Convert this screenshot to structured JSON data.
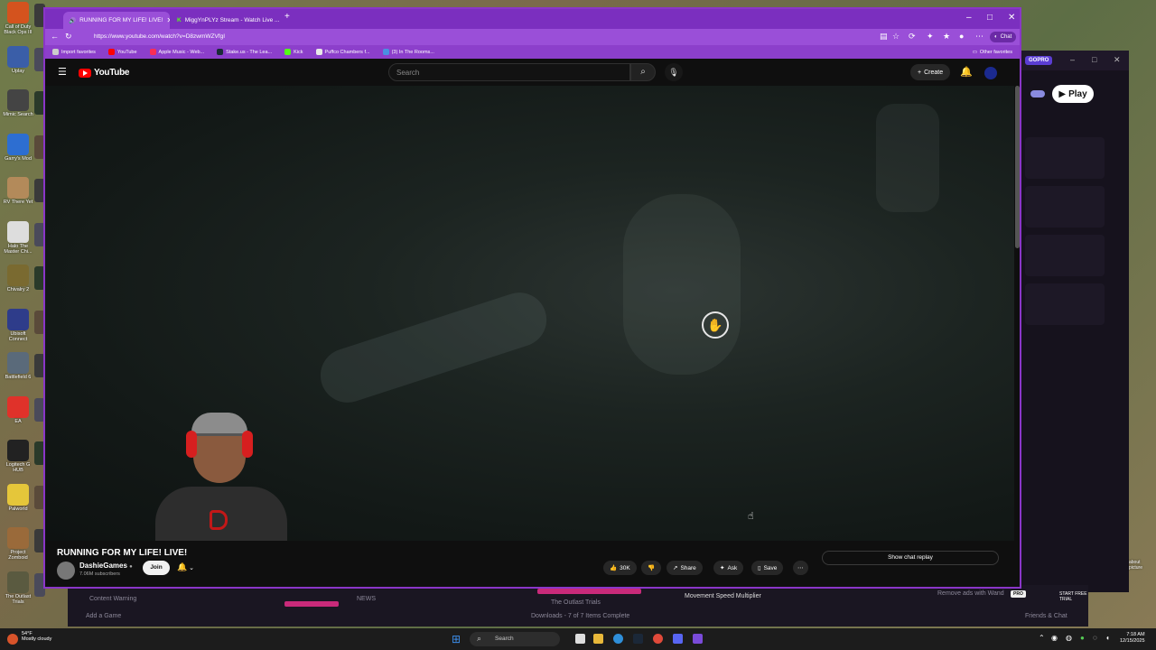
{
  "desktop": {
    "icons": [
      {
        "label": "Call of Duty Black Ops III",
        "color": "#d4531e"
      },
      {
        "label": "Uplay",
        "color": "#3a5ea8"
      },
      {
        "label": "Mimic Search",
        "color": "#444444"
      },
      {
        "label": "Garry's Mod",
        "color": "#2d6ed1"
      },
      {
        "label": "RV There Yet",
        "color": "#b38a5a"
      },
      {
        "label": "Halo The Master Chi...",
        "color": "#dddddd"
      },
      {
        "label": "Chivalry 2",
        "color": "#7a6a30"
      },
      {
        "label": "Ubisoft Connect",
        "color": "#2e3c8a"
      },
      {
        "label": "Battlefield 6",
        "color": "#5a6a7a"
      },
      {
        "label": "EA",
        "color": "#e0322a"
      },
      {
        "label": "Logitech G HUB",
        "color": "#222222"
      },
      {
        "label": "Palworld",
        "color": "#e5c63a"
      },
      {
        "label": "Project Zomboid",
        "color": "#9a6a3a"
      },
      {
        "label": "The Outlast Trials",
        "color": "#5a5a40"
      }
    ]
  },
  "browser": {
    "tabs": [
      {
        "title": "RUNNING FOR MY LIFE! LIVE!",
        "active": true
      },
      {
        "title": "MiggYnPLYz Stream - Watch Live ...",
        "active": false
      }
    ],
    "new_tab": "+",
    "url": "https://www.youtube.com/watch?v=D8zwmWZVfgI",
    "chat_label": "Chat",
    "bookmarks": [
      {
        "label": "Import favorites",
        "color": "#cccccc"
      },
      {
        "label": "YouTube",
        "color": "#ff0000"
      },
      {
        "label": "Apple Music - Web...",
        "color": "#fa2d55"
      },
      {
        "label": "Stake.us - The Lea...",
        "color": "#1a2c38"
      },
      {
        "label": "Kick",
        "color": "#53fc18"
      },
      {
        "label": "Puffco Chambers f...",
        "color": "#e8e8e8"
      },
      {
        "label": "(3) In The Rooms...",
        "color": "#4a90e2"
      }
    ],
    "other_favorites": "Other favorites"
  },
  "youtube": {
    "logo": "YouTube",
    "search_placeholder": "Search",
    "create_label": "Create",
    "video_title": "RUNNING FOR MY LIFE! LIVE!",
    "channel_name": "DashieGames",
    "subscribers": "7.06M subscribers",
    "join_label": "Join",
    "likes": "30K",
    "share_label": "Share",
    "ask_label": "Ask",
    "save_label": "Save",
    "show_chat_replay": "Show chat replay"
  },
  "background_app": {
    "gopro_label": "GOPRO",
    "play_label": "Play"
  },
  "launcher_strip": {
    "content_warning": "Content Warning",
    "news": "NEWS",
    "outlast": "The Outlast Trials",
    "movement": "Movement Speed Multiplier",
    "remove_ads": "Remove ads with Wand",
    "pro_tag": "PRO",
    "free_trial": "START FREE TRIAL",
    "add_game": "Add a Game",
    "downloads": "Downloads - 7 of 7 Items Complete",
    "friends_chat": "Friends & Chat",
    "pip_text": "about picture"
  },
  "taskbar": {
    "temperature": "54°F",
    "weather": "Mostly cloudy",
    "search_label": "Search",
    "time": "7:18 AM",
    "date": "12/15/2025"
  }
}
